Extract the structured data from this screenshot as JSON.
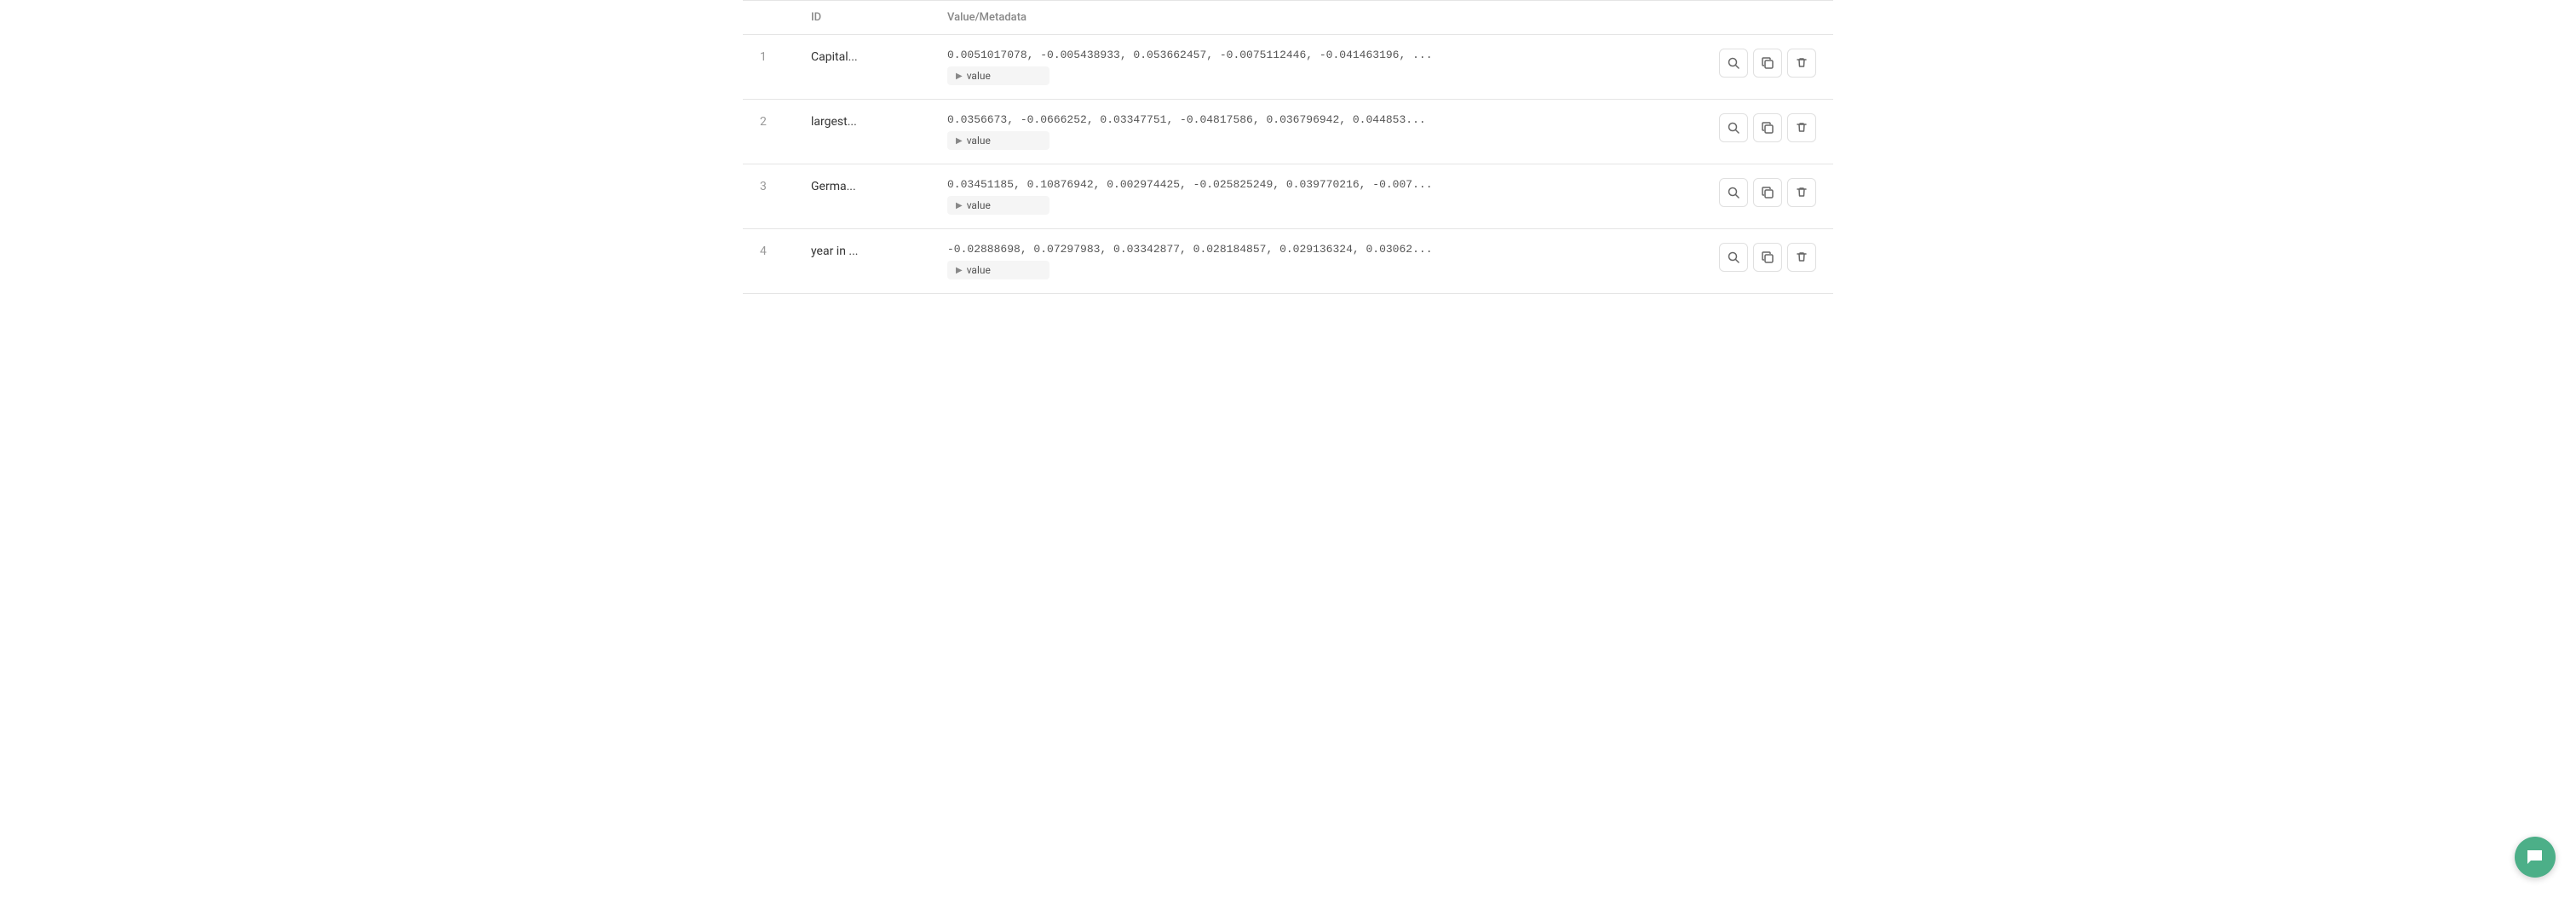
{
  "table": {
    "headers": {
      "index": "",
      "id": "ID",
      "value": "Value/Metadata",
      "actions": ""
    },
    "rows": [
      {
        "number": "1",
        "id": "Capital...",
        "value_text": "0.0051017078, -0.005438933, 0.053662457, -0.0075112446, -0.041463196, ...",
        "value_expand": "value"
      },
      {
        "number": "2",
        "id": "largest...",
        "value_text": "0.0356673, -0.0666252, 0.03347751, -0.04817586, 0.036796942, 0.044853...",
        "value_expand": "value"
      },
      {
        "number": "3",
        "id": "Germa...",
        "value_text": "0.03451185, 0.10876942, 0.002974425, -0.025825249, 0.039770216, -0.007...",
        "value_expand": "value"
      },
      {
        "number": "4",
        "id": "year in ...",
        "value_text": "-0.02888698, 0.07297983, 0.03342877, 0.028184857, 0.029136324, 0.03062...",
        "value_expand": "value"
      }
    ],
    "action_icons": {
      "search": "🔍",
      "copy": "⧉",
      "delete": "🗑"
    }
  },
  "chat_bubble_icon": "💬"
}
